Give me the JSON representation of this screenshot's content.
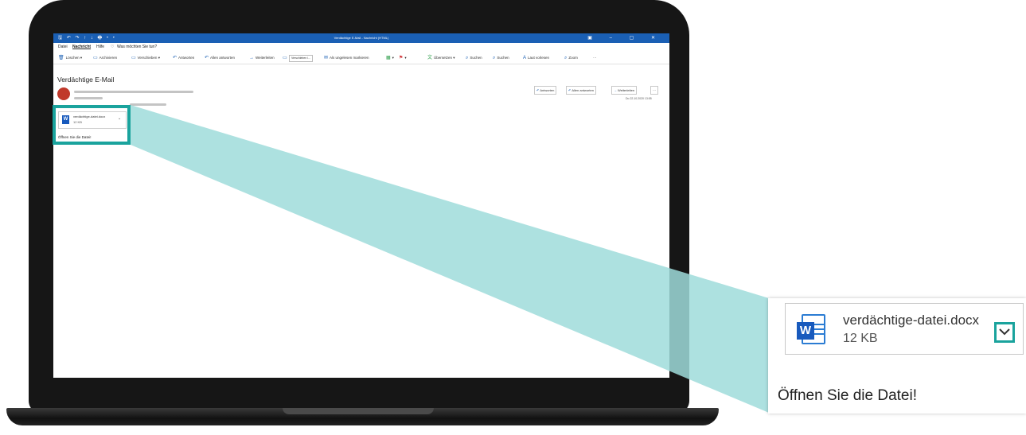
{
  "titlebar": {
    "title": "Verdächtige E-Mail - Nachricht (HTML)",
    "quick_access": "🖫 ↶ ↷ ↑ ↓ 🖶 ▾ ▾",
    "window_controls": "▣ – ▢ ✕"
  },
  "menu": {
    "file": "Datei",
    "message": "Nachricht",
    "help": "Hilfe",
    "tell_me": "Was möchten Sie tun?"
  },
  "toolbar": {
    "delete": "Löschen",
    "archive": "Archivieren",
    "move": "Verschieben",
    "reply": "Antworten",
    "reply_all": "Allen antworten",
    "forward": "Weiterleiten",
    "move_to": "Verschieben i...",
    "mark_unread": "Als ungelesen markieren",
    "translate": "Übersetzen",
    "search1": "Suchen",
    "search2": "Suchen",
    "read_aloud": "Laut vorlesen",
    "zoom": "Zoom",
    "more": "···"
  },
  "message": {
    "subject": "Verdächtige E-Mail",
    "date": "Do 22.10.2020 13:55",
    "actions": {
      "reply": "Antworten",
      "reply_all": "Allen antworten",
      "forward": "Weiterleiten",
      "more": "···"
    },
    "attachment": {
      "name": "verdächtige-datei.docx",
      "size": "12 KB",
      "icon": "word-doc-icon"
    },
    "body": "Öffnen Sie die Datei!"
  },
  "colors": {
    "accent": "#1a5fb4",
    "highlight": "#1aa39d",
    "beam": "#9fdcda"
  }
}
